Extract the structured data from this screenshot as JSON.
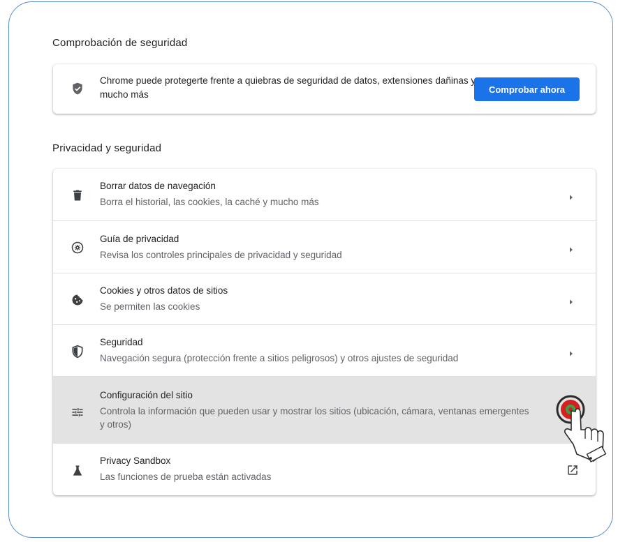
{
  "safety_check": {
    "section_title": "Comprobación de seguridad",
    "description": "Chrome puede protegerte frente a quiebras de seguridad de datos, extensiones dañinas y mucho más",
    "button_label": "Comprobar ahora",
    "icon": "shield-check-icon"
  },
  "privacy": {
    "section_title": "Privacidad y seguridad",
    "rows": [
      {
        "label": "Borrar datos de navegación",
        "sub": "Borra el historial, las cookies, la caché y mucho más",
        "icon": "trash-icon",
        "action": "arrow-right-icon"
      },
      {
        "label": "Guía de privacidad",
        "sub": "Revisa los controles principales de privacidad y seguridad",
        "icon": "compass-icon",
        "action": "arrow-right-icon"
      },
      {
        "label": "Cookies y otros datos de sitios",
        "sub": "Se permiten las cookies",
        "icon": "cookie-icon",
        "action": "arrow-right-icon"
      },
      {
        "label": "Seguridad",
        "sub": "Navegación segura (protección frente a sitios peligrosos) y otros ajustes de seguridad",
        "icon": "shield-icon",
        "action": "arrow-right-icon"
      },
      {
        "label": "Configuración del sitio",
        "sub": "Controla la información que pueden usar y mostrar los sitios (ubicación, cámara, ventanas emergentes y otros)",
        "icon": "tune-icon",
        "action": "arrow-right-icon",
        "highlighted": true
      },
      {
        "label": "Privacy Sandbox",
        "sub": "Las funciones de prueba están activadas",
        "icon": "flask-icon",
        "action": "open-external-icon"
      }
    ]
  },
  "colors": {
    "accent": "#1a73e8",
    "highlight_row": "#e3e3e3",
    "frame": "#5b8fc9"
  }
}
